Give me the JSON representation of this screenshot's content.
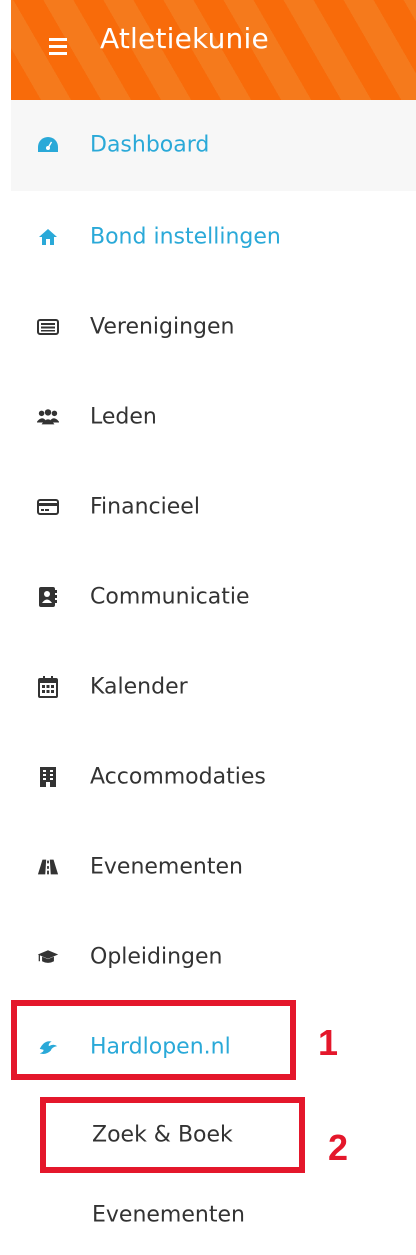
{
  "header": {
    "title": "Atletiekunie",
    "menu_icon": "hamburger-icon"
  },
  "nav": {
    "dashboard": "Dashboard",
    "bond": "Bond instellingen",
    "verenigingen": "Verenigingen",
    "leden": "Leden",
    "financieel": "Financieel",
    "communicatie": "Communicatie",
    "kalender": "Kalender",
    "accommodaties": "Accommodaties",
    "evenementen": "Evenementen",
    "opleidingen": "Opleidingen",
    "hardlopen": "Hardlopen.nl"
  },
  "subnav": {
    "zoek_boek": "Zoek & Boek",
    "evenementen": "Evenementen"
  },
  "annotations": {
    "one": "1",
    "two": "2"
  },
  "colors": {
    "accent": "#2aa9d8",
    "header": "#f86b0a",
    "annotation": "#e4172b",
    "text": "#333333"
  }
}
